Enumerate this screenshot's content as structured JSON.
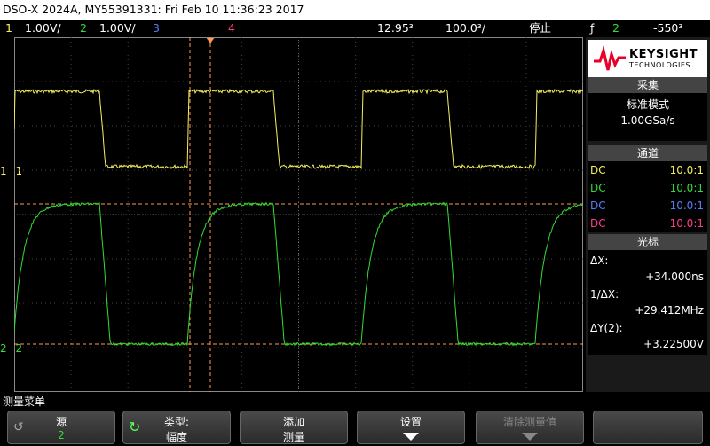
{
  "title": "DSO-X 2024A, MY55391331: Fri Feb 10 11:36:23 2017",
  "status": {
    "ch1_num": "1",
    "ch1_scale": "1.00V/",
    "ch2_num": "2",
    "ch2_scale": "1.00V/",
    "ch3_num": "3",
    "ch4_num": "4",
    "delay": "12.95³",
    "timebase": "100.0³/",
    "run_state": "停止",
    "trig_symbol": "ƒ",
    "trig_ch": "2",
    "trig_level": "-550³"
  },
  "markers": {
    "ch1_label": "1",
    "ch2_label": "2"
  },
  "colors": {
    "ch1": "#f5f060",
    "ch2": "#33dd33",
    "ch3": "#5a7cff",
    "ch4": "#ff3c8c",
    "cursor": "#ff9955"
  },
  "brand": {
    "line1": "KEYSIGHT",
    "line2": "TECHNOLOGIES"
  },
  "acquisition": {
    "header": "采集",
    "mode": "标准模式",
    "rate": "1.00GSa/s"
  },
  "channels": {
    "header": "通道",
    "rows": [
      {
        "coupling": "DC",
        "ratio": "10.0:1"
      },
      {
        "coupling": "DC",
        "ratio": "10.0:1"
      },
      {
        "coupling": "DC",
        "ratio": "10.0:1"
      },
      {
        "coupling": "DC",
        "ratio": "10.0:1"
      }
    ]
  },
  "cursors": {
    "header": "光标",
    "dx_label": "ΔX:",
    "dx_value": "+34.000ns",
    "inv_label": "1/ΔX:",
    "inv_value": "+29.412MHz",
    "dy_label": "ΔY(2):",
    "dy_value": "+3.22500V"
  },
  "menu_title": "测量菜单",
  "softkeys": {
    "source_label": "源",
    "source_value": "2",
    "type_label": "类型:",
    "type_value": "幅度",
    "add_label": "添加",
    "add_value": "测量",
    "settings_label": "设置",
    "clear_label": "清除测量值"
  }
}
